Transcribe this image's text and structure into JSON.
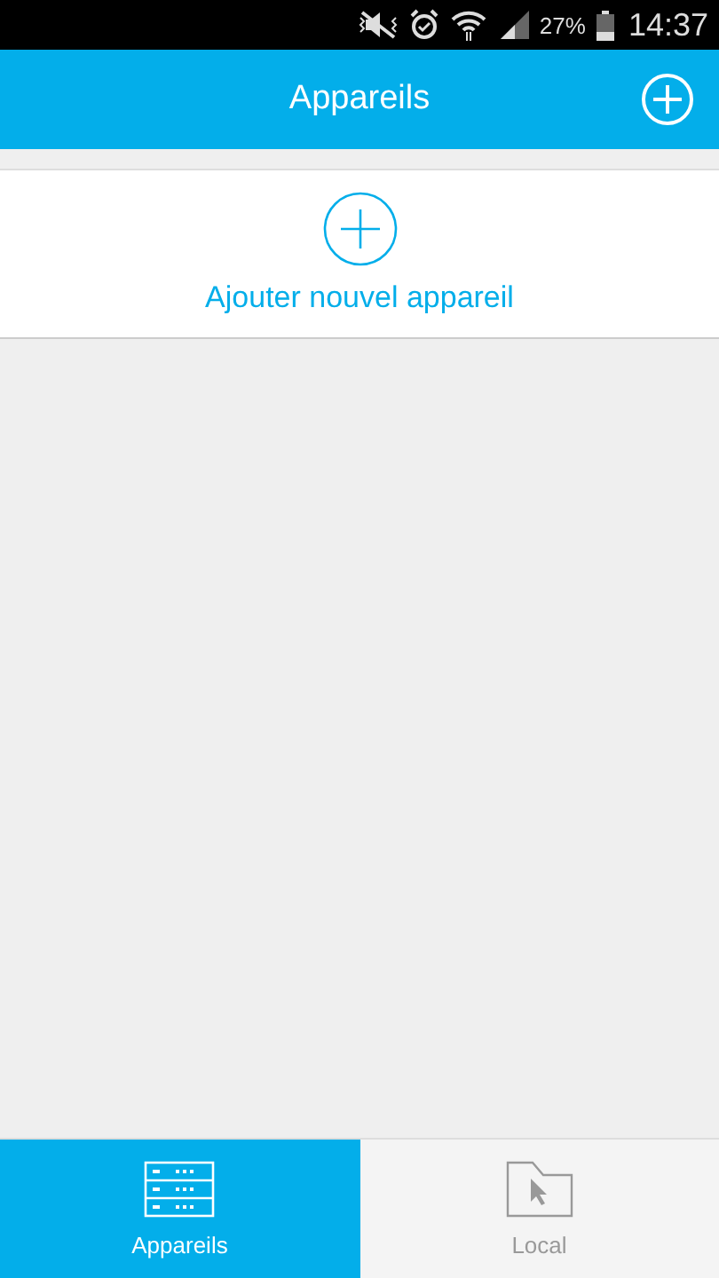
{
  "status_bar": {
    "battery": "27%",
    "time": "14:37"
  },
  "header": {
    "title": "Appareils"
  },
  "add_card": {
    "label": "Ajouter nouvel appareil"
  },
  "tabs": [
    {
      "label": "Appareils",
      "kind": "devices",
      "selected": true
    },
    {
      "label": "Local",
      "kind": "folder",
      "selected": false
    }
  ]
}
